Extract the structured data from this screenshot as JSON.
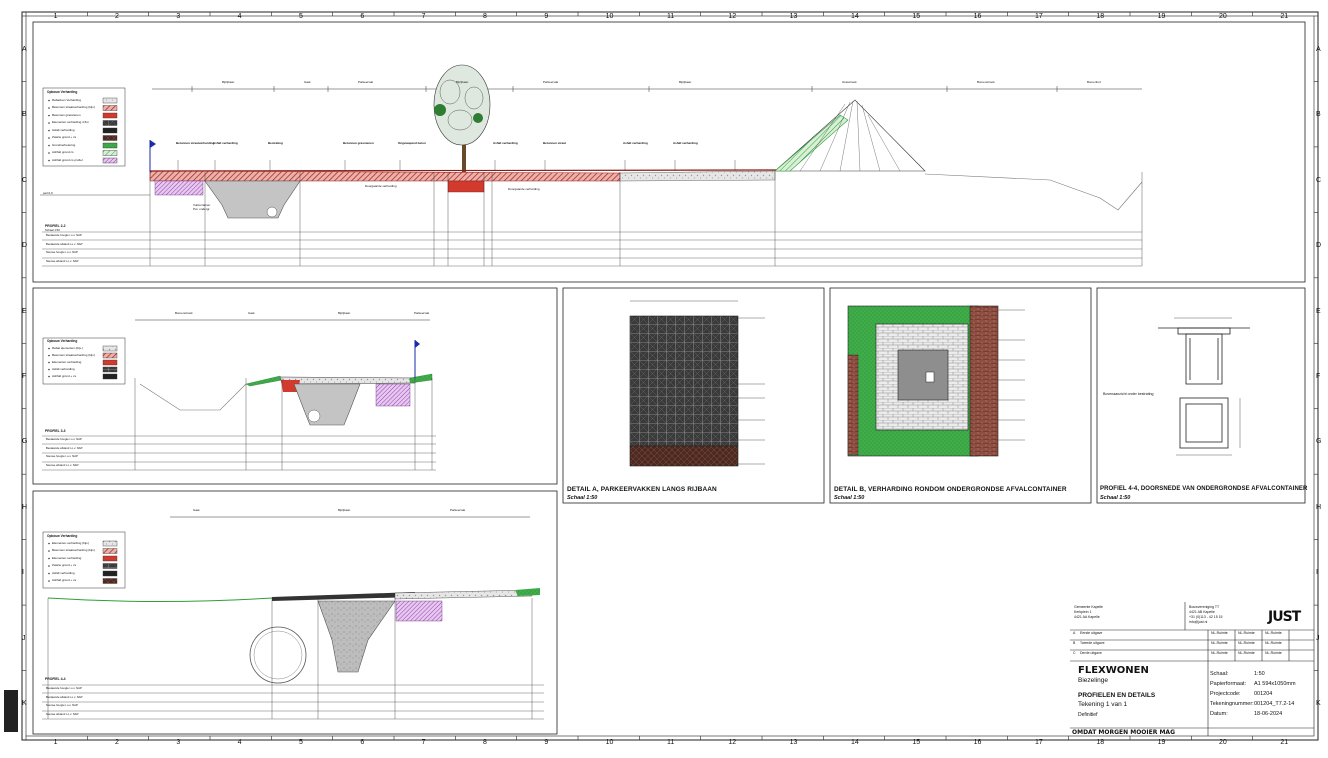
{
  "sheet": {
    "grid_numbers": [
      "1",
      "2",
      "3",
      "4",
      "5",
      "6",
      "7",
      "8",
      "9",
      "10",
      "11",
      "12",
      "13",
      "14",
      "15",
      "16",
      "17",
      "18",
      "19",
      "20",
      "21"
    ],
    "grid_letters": [
      "A",
      "B",
      "C",
      "D",
      "E",
      "F",
      "G",
      "H",
      "I",
      "J",
      "K"
    ]
  },
  "panels": {
    "profile_b": {
      "legend_title": "Opbouw Verharding",
      "legend_items": [
        "Rabatinen Verharding",
        "Betonnen straatverharding (bijv.)",
        "Betonnen grasstenen",
        "Elementen verharding 4,5m",
        "Asfalt verharding",
        "Zwarte grond + cs",
        "Grondverbetering",
        "Ashfalt grond cs",
        "Ashfalt grond cs profiel"
      ],
      "dim_labels": [
        "Bijrijbaan",
        "Gaat",
        "Parkeervak",
        "Bijrijbaan",
        "Parkeervak",
        "Bijrijbaan",
        "Grasstrook",
        "Bomenstrook",
        "Bomenhof"
      ],
      "peil": "peil 0,0",
      "profile_name": "PROFIEL 2-2",
      "profile_scale": "Schaal 1:50",
      "rows": [
        "Bestaande hoogte t.o.v. NAP",
        "Bestaande afstand t.o.v. NAP",
        "Nieuwe hoogte t.o.v. NAP",
        "Nieuwe afstand t.o.v. NAP"
      ],
      "annotations": [
        "Betonnen straatverharding",
        "Asfalt verharding",
        "Bestrating",
        "Betonnen grasstenen",
        "Ongewapend beton",
        "Asfalt verharding",
        "Betonnen straat",
        "Asfalt verharding",
        "Asfalt verharding"
      ],
      "container_note": "Vuilcontainer",
      "container_note2": "Pot. ondergr.",
      "road_note": "Doorgaande verharding",
      "road_note2": "Doorgaande verharding"
    },
    "profile_c": {
      "legend_title": "Opbouw Verharding",
      "legend_items": [
        "Rabat elementen (bijv.)",
        "Betonnen straatverharding (bijv.)",
        "Elementen verharding",
        "Asfalt verharding",
        "Ashfalt grond + cs"
      ],
      "dim_labels": [
        "Bomenstrook",
        "Gaat",
        "Bijrijbaan",
        "Parkeervak"
      ],
      "profile_name": "PROFIEL 3-3",
      "rows": [
        "Bestaande hoogte t.o.v. NAP",
        "Bestaande afstand t.o.v. NAP",
        "Nieuwe hoogte t.o.v. NAP",
        "Nieuwe afstand t.o.v. NAP"
      ]
    },
    "profile_d": {
      "legend_title": "Opbouw Verharding",
      "legend_items": [
        "Elementen verharding (bijv.)",
        "Betonnen straatverharding (bijv.)",
        "Elementen verharding",
        "Zwarte grond + cs",
        "Asfalt verharding",
        "Ashfalt grond + cs"
      ],
      "dim_labels": [
        "Gaat",
        "Bijrijbaan",
        "Parkeervak"
      ],
      "profile_name": "PROFIEL 4-4",
      "rows": [
        "Bestaande hoogte t.o.v. NAP",
        "Bestaande afstand t.o.v. NAP",
        "Nieuwe hoogte t.o.v. NAP",
        "Nieuwe afstand t.o.v. NAP"
      ]
    },
    "detail_a": {
      "title": "DETAIL A, PARKEERVAKKEN LANGS RIJBAAN",
      "scale": "Schaal 1:50"
    },
    "detail_b": {
      "title": "DETAIL B, VERHARDING RONDOM ONDERGRONDSE AFVALCONTAINER",
      "scale": "Schaal 1:50"
    },
    "profile_44": {
      "title": "PROFIEL 4-4, DOORSNEDE VAN ONDERGRONDSE AFVALCONTAINER",
      "scale": "Schaal 1:50",
      "note": "Bovenaanzicht onder bestrating"
    }
  },
  "titleblock": {
    "client_lines": [
      "Gemeente Kapelle",
      "Kerkplein 1",
      "4421 AA Kapelle"
    ],
    "office_lines": [
      "Bouwvereniging TT",
      "4421 AB Kapelle",
      "+31 (0)113 - 42 15 15",
      "info@just.nl"
    ],
    "logo": "JUST",
    "revisions": [
      {
        "code": "A",
        "desc": "Eerste uitgave",
        "d1": "NL-Ruimte",
        "d2": "NL-Ruimte",
        "d3": "NL-Ruimte"
      },
      {
        "code": "B",
        "desc": "Tweede uitgave",
        "d1": "NL-Ruimte",
        "d2": "NL-Ruimte",
        "d3": "NL-Ruimte"
      },
      {
        "code": "C",
        "desc": "Derde uitgave",
        "d1": "NL-Ruimte",
        "d2": "NL-Ruimte",
        "d3": "NL-Ruimte"
      }
    ],
    "project": "FLEXWONEN",
    "location": "Biezelinge",
    "drawing_title": "PROFIELEN EN DETAILS",
    "sheet_of": "Tekening 1 van 1",
    "status": "Definitief",
    "fields": [
      {
        "label": "Schaal:",
        "value": "1:50"
      },
      {
        "label": "Papierformaat:",
        "value": "A1 594x1050mm"
      },
      {
        "label": "Projectcode:",
        "value": "001204"
      },
      {
        "label": "Tekeningnummer:",
        "value": "001204_T7.2-14"
      },
      {
        "label": "Datum:",
        "value": "18-06-2024"
      }
    ],
    "slogan": "OMDAT MORGEN MOOIER MAG"
  },
  "colors": {
    "red_hatch": "#c0392b",
    "green": "#2e9e3c",
    "purple": "#9b59b6",
    "grey_conc": "#9a9a9a",
    "brick": "#7a3b2e"
  }
}
